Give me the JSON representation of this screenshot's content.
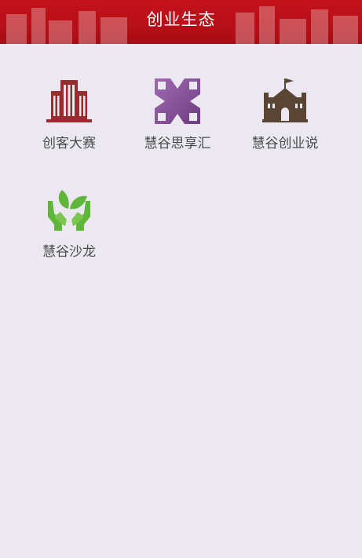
{
  "header": {
    "title": "创业生态"
  },
  "tiles": [
    {
      "label": "创客大赛",
      "icon": "office-building-icon",
      "color": "#9a2b2e"
    },
    {
      "label": "慧谷思享汇",
      "icon": "cross-x-icon",
      "color": "#8a4f98"
    },
    {
      "label": "慧谷创业说",
      "icon": "castle-building-icon",
      "color": "#5a4534"
    },
    {
      "label": "慧谷沙龙",
      "icon": "hands-leaf-icon",
      "color": "#5fb63b"
    }
  ],
  "colors": {
    "header_red": "#c3121b",
    "background": "#ece8f1",
    "label_text": "#4b4b4b"
  }
}
